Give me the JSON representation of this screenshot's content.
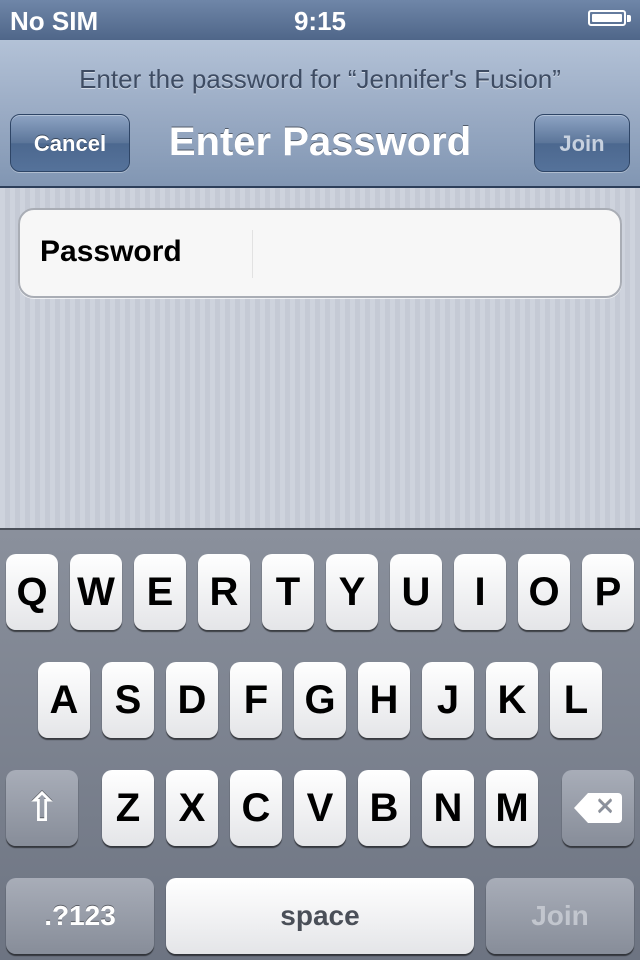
{
  "status_bar": {
    "carrier": "No SIM",
    "time": "9:15",
    "battery_level": 1.0
  },
  "nav_bar": {
    "prompt": "Enter the password for “Jennifer's Fusion”",
    "title": "Enter Password",
    "cancel_label": "Cancel",
    "join_label": "Join",
    "join_enabled": false
  },
  "form": {
    "password_label": "Password",
    "password_value": ""
  },
  "keyboard": {
    "row1": [
      "Q",
      "W",
      "E",
      "R",
      "T",
      "Y",
      "U",
      "I",
      "O",
      "P"
    ],
    "row2": [
      "A",
      "S",
      "D",
      "F",
      "G",
      "H",
      "J",
      "K",
      "L"
    ],
    "row3": [
      "Z",
      "X",
      "C",
      "V",
      "B",
      "N",
      "M"
    ],
    "numbers_label": ".?123",
    "space_label": "space",
    "join_label": "Join",
    "shift_icon": "shift-icon",
    "backspace_icon": "backspace-icon"
  },
  "colors": {
    "nav_bar": "#9aabc4",
    "keyboard": "#7a808d"
  }
}
